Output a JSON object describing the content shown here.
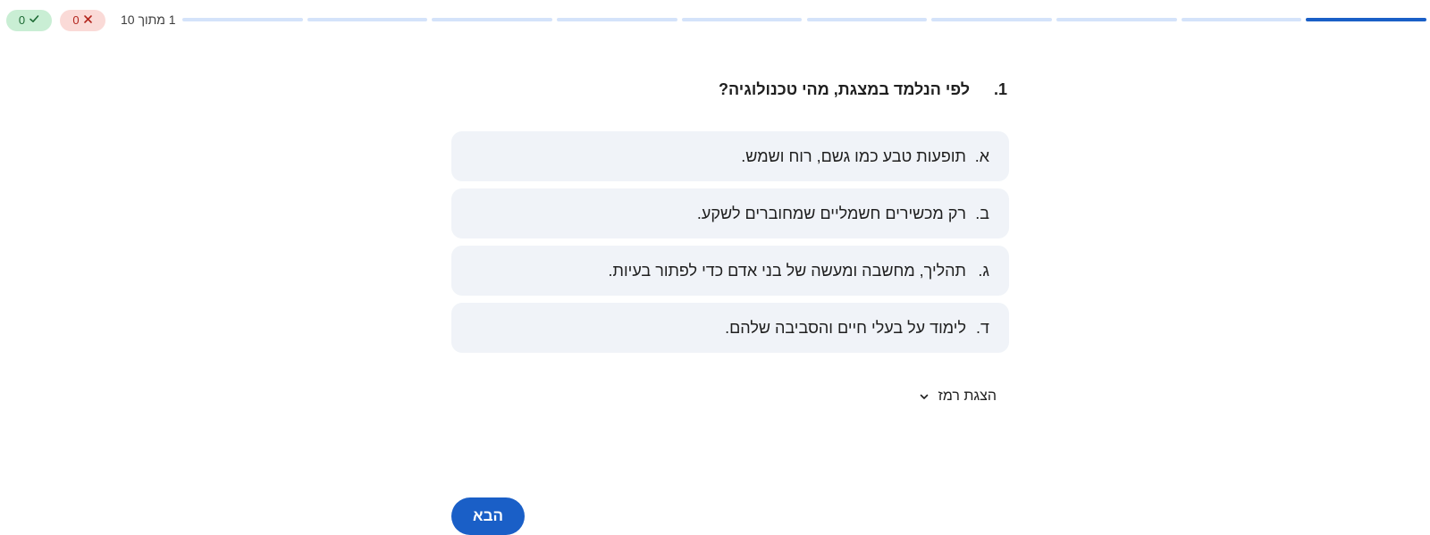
{
  "score": {
    "correct_count": "0",
    "wrong_count": "0",
    "correct_icon": "check-icon",
    "wrong_icon": "x-icon"
  },
  "progress": {
    "label": "1 מתוך 10",
    "current": 1,
    "total": 10,
    "active_color": "#1a5fc7",
    "inactive_color": "#d4e3fa"
  },
  "question": {
    "number": "1.",
    "text": "לפי הנלמד במצגת, מהי טכנולוגיה?"
  },
  "options": [
    {
      "letter": "א.",
      "text": "תופעות טבע כמו גשם, רוח ושמש."
    },
    {
      "letter": "ב.",
      "text": "רק מכשירים חשמליים שמחוברים לשקע."
    },
    {
      "letter": "ג.",
      "text": "תהליך, מחשבה ומעשה של בני אדם כדי לפתור בעיות."
    },
    {
      "letter": "ד.",
      "text": "לימוד על בעלי חיים והסביבה שלהם."
    }
  ],
  "hint": {
    "label": "הצגת רמז",
    "icon": "chevron-down-icon"
  },
  "next_button": {
    "label": "הבא"
  }
}
